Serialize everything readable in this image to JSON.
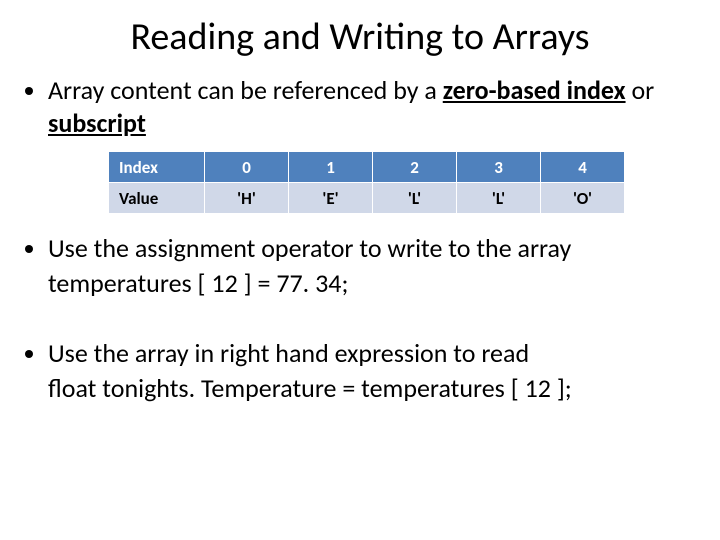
{
  "title": "Reading and Writing to Arrays",
  "bullet1": {
    "prefix": "Array content can be referenced by a ",
    "underlined1": "zero-based index",
    "mid": " or ",
    "underlined2": "subscript"
  },
  "table": {
    "index_label": "Index",
    "value_label": "Value",
    "idx0": "0",
    "idx1": "1",
    "idx2": "2",
    "idx3": "3",
    "idx4": "4",
    "val0": "'H'",
    "val1": "'E'",
    "val2": "'L'",
    "val3": "'L'",
    "val4": "'O'"
  },
  "bullet2": {
    "line1": "Use the assignment operator to write to the array",
    "line2": "temperatures [ 12 ] = 77. 34;"
  },
  "bullet3": {
    "line1": "Use the array in right hand expression to read",
    "line2": "float tonights. Temperature = temperatures [ 12 ];"
  }
}
